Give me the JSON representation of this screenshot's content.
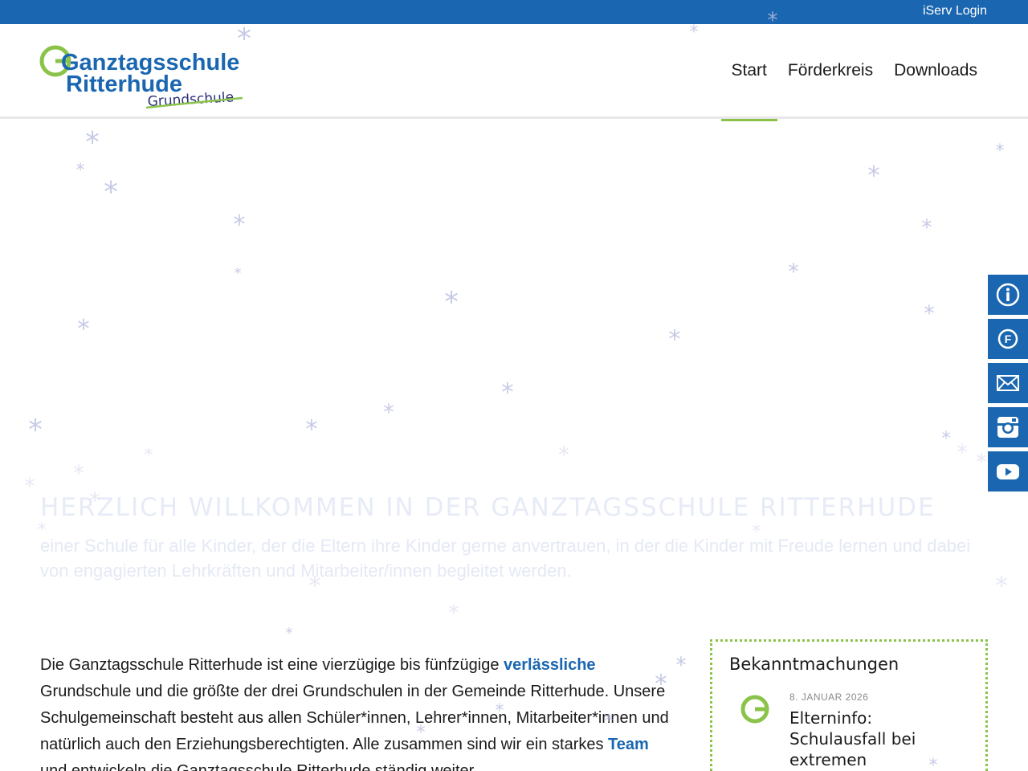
{
  "topbar": {
    "login_label": "iServ Login"
  },
  "logo": {
    "line1": "Ganztagsschule",
    "line2": "Ritterhude",
    "line3": "Grundschule",
    "initial": "G"
  },
  "nav": {
    "items": [
      "Start",
      "Förderkreis",
      "Downloads"
    ],
    "active": "Start"
  },
  "welcome": {
    "heading": "HERZLICH WILLKOMMEN IN DER GANZTAGSSCHULE RITTERHUDE",
    "text": "einer Schule für alle Kinder, der die Eltern ihre Kinder gerne anvertrauen, in der die Kinder mit Freude lernen und dabei von engagierten Lehrkräften und Mitarbeiter/innen begleitet werden."
  },
  "intro": {
    "part1": "Die Ganztagsschule Ritterhude ist eine vierzügige bis fünfzügige ",
    "link1": "verlässliche",
    "part2": " Grundschule und die größte der drei Grundschulen in der Gemeinde Ritterhude. Unsere Schulgemeinschaft besteht aus allen Schüler*innen, Lehrer*innen, Mitarbeiter*innen und natürlich auch den Erziehungsberechtigten. Alle zusammen sind wir ein starkes ",
    "link2": "Team",
    "part3": " und entwickeln die Ganztagsschule Ritterhude ständig weiter."
  },
  "announcements": {
    "heading": "Bekanntmachungen",
    "item": {
      "date": "8. JANUAR 2026",
      "title": "Elterninfo: Schulausfall bei extremen"
    }
  },
  "side_buttons": [
    {
      "icon": "info-icon"
    },
    {
      "icon": "foerderkreis-icon",
      "letter": "F"
    },
    {
      "icon": "mail-icon"
    },
    {
      "icon": "instagram-icon"
    },
    {
      "icon": "youtube-icon"
    }
  ],
  "colors": {
    "brand_blue": "#1a66b0",
    "accent_green": "#8bc34a",
    "snow": "#b8bde0"
  }
}
